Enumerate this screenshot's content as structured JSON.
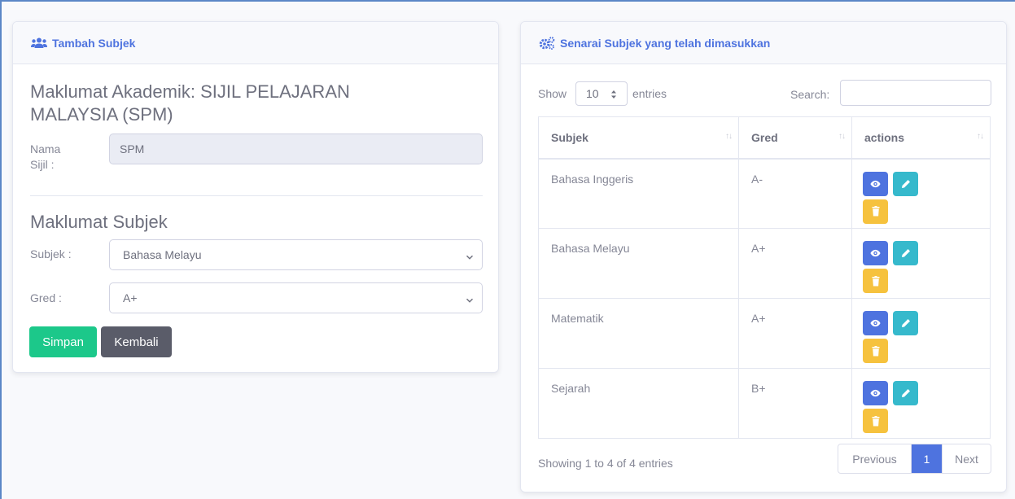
{
  "left_card": {
    "header": "Tambah Subjek",
    "academic_title": "Maklumat Akademik: SIJIL PELAJARAN MALAYSIA (SPM)",
    "certificate_label": "Nama Sijil :",
    "certificate_value": "SPM",
    "subject_section_title": "Maklumat Subjek",
    "subject_label": "Subjek :",
    "subject_value": "Bahasa Melayu",
    "grade_label": "Gred :",
    "grade_value": "A+",
    "save_label": "Simpan",
    "back_label": "Kembali"
  },
  "right_card": {
    "header": "Senarai Subjek yang telah dimasukkan",
    "show_label": "Show",
    "entries_value": "10",
    "entries_label": "entries",
    "search_label": "Search:",
    "search_value": "",
    "columns": [
      "Subjek",
      "Gred",
      "actions"
    ],
    "rows": [
      {
        "subject": "Bahasa Inggeris",
        "grade": "A-"
      },
      {
        "subject": "Bahasa Melayu",
        "grade": "A+"
      },
      {
        "subject": "Matematik",
        "grade": "A+"
      },
      {
        "subject": "Sejarah",
        "grade": "B+"
      }
    ],
    "info": "Showing 1 to 4 of 4 entries",
    "pagination": {
      "previous": "Previous",
      "current": "1",
      "next": "Next"
    }
  },
  "icons": {
    "left_header": "users-icon",
    "right_header": "cogs-icon",
    "view": "eye-icon",
    "edit": "pencil-icon",
    "delete": "trash-icon"
  },
  "colors": {
    "primary": "#4e73df",
    "success": "#1cc88a",
    "dark": "#5a5c69",
    "info": "#36b9cc",
    "warning": "#f6c23e"
  }
}
